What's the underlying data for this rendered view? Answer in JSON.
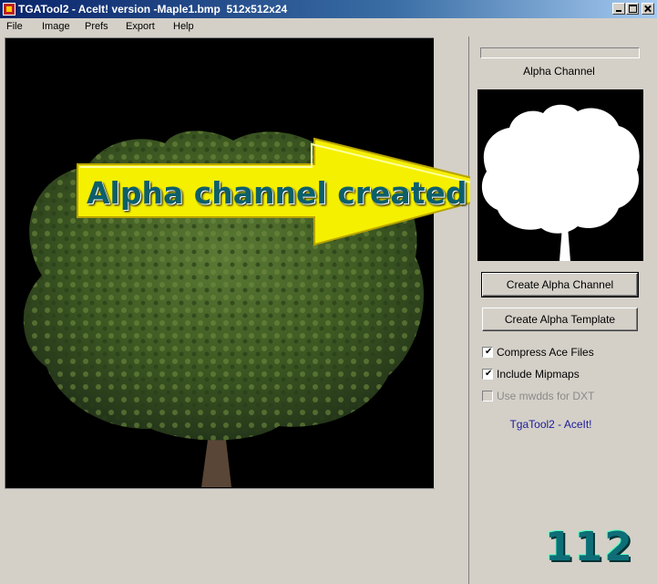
{
  "window": {
    "title": "TGATool2 - AceIt! version -Maple1.bmp  512x512x24",
    "icon": "app-icon"
  },
  "menu": [
    "File",
    "Image",
    "Prefs",
    "Export",
    "Help"
  ],
  "right_panel": {
    "alpha_label": "Alpha Channel",
    "create_alpha_button": "Create Alpha Channel",
    "create_template_button": "Create Alpha Template",
    "options": [
      {
        "label": "Compress Ace Files",
        "checked": true,
        "enabled": true
      },
      {
        "label": "Include Mipmaps",
        "checked": true,
        "enabled": true
      },
      {
        "label": "Use mwdds for DXT",
        "checked": false,
        "enabled": false
      }
    ],
    "footer_text": "TgaTool2 - AceIt!"
  },
  "annotation": {
    "text": "Alpha channel created",
    "arrow_color": "#f5f000"
  },
  "page_number": "112",
  "colors": {
    "face": "#d4d0c8",
    "titlebar_start": "#0a246a",
    "canvas": "#000000",
    "tree_foliage": "#3e5a22",
    "footer_text": "#1a1a9a"
  }
}
